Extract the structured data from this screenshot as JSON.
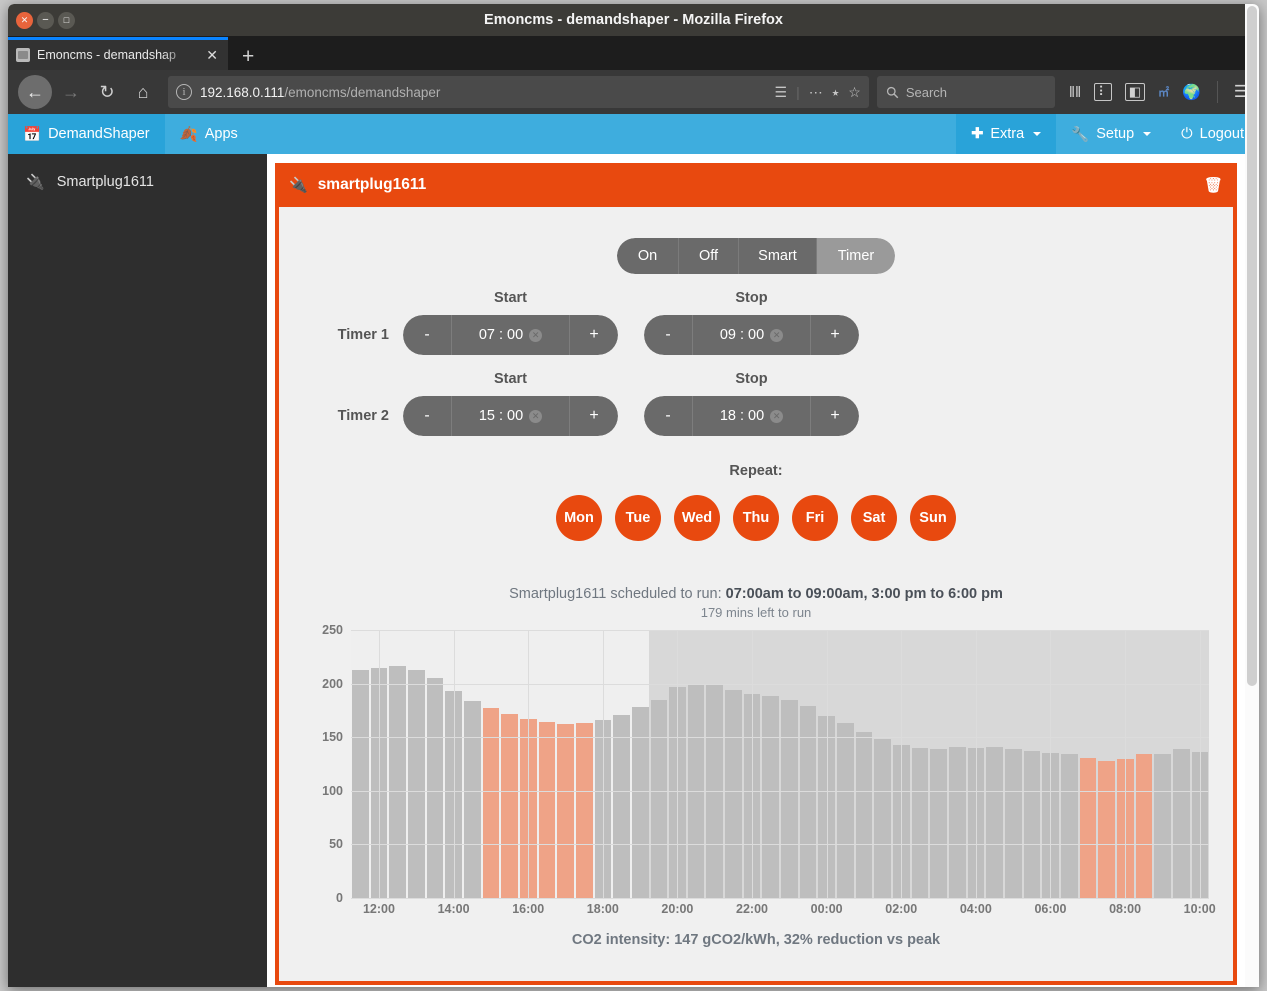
{
  "window": {
    "title": "Emoncms - demandshaper - Mozilla Firefox",
    "close_label": "✕",
    "minimize_label": "−",
    "maximize_label": "□"
  },
  "browser": {
    "tab": {
      "title": "Emoncms - demandshap",
      "close_label": "✕"
    },
    "new_tab_label": "+",
    "back_label": "←",
    "forward_label": "→",
    "reload_label": "↻",
    "home_label": "⌂",
    "url": {
      "host": "192.168.0.111",
      "path": "/emoncms/demandshaper",
      "info_label": "i"
    },
    "url_icons": {
      "reader": "☰",
      "more": "⋯",
      "pocket": "⭑",
      "bookmark": "☆"
    },
    "search": {
      "placeholder": "Search",
      "icon": "search-icon"
    },
    "toolbar_icons": [
      "library-icon",
      "sidebar-icon",
      "page-icon",
      "lt-icon",
      "globe-icon",
      "menu-icon"
    ]
  },
  "topnav": {
    "brand": {
      "label": "DemandShaper",
      "icon": "calendar-icon"
    },
    "apps": {
      "label": "Apps",
      "icon": "leaf-icon"
    },
    "extra": {
      "label": "Extra",
      "icon": "plus-icon"
    },
    "setup": {
      "label": "Setup",
      "icon": "wrench-icon"
    },
    "logout": {
      "label": "Logout",
      "icon": "power-icon"
    }
  },
  "sidebar": {
    "items": [
      {
        "label": "Smartplug1611",
        "icon": "plug-icon"
      }
    ]
  },
  "panel": {
    "title": "smartplug1611",
    "icon": "plug-icon",
    "delete_label": "delete-icon"
  },
  "modes": {
    "options": [
      "On",
      "Off",
      "Smart",
      "Timer"
    ],
    "selected": "Timer"
  },
  "timers": [
    {
      "name": "Timer 1",
      "start_label": "Start",
      "stop_label": "Stop",
      "start_value": "07 : 00",
      "stop_value": "09 : 00",
      "minus_label": "-",
      "plus_label": "+",
      "clear_label": "✕"
    },
    {
      "name": "Timer 2",
      "start_label": "Start",
      "stop_label": "Stop",
      "start_value": "15 : 00",
      "stop_value": "18 : 00",
      "minus_label": "-",
      "plus_label": "+",
      "clear_label": "✕"
    }
  ],
  "repeat": {
    "label": "Repeat:",
    "days": [
      {
        "label": "Mon",
        "active": true
      },
      {
        "label": "Tue",
        "active": true
      },
      {
        "label": "Wed",
        "active": true
      },
      {
        "label": "Thu",
        "active": true
      },
      {
        "label": "Fri",
        "active": true
      },
      {
        "label": "Sat",
        "active": true
      },
      {
        "label": "Sun",
        "active": true
      }
    ]
  },
  "schedule": {
    "prefix": "Smartplug1611 scheduled to run: ",
    "times": "07:00am to 09:00am, 3:00 pm to 6:00 pm",
    "remaining": "179 mins left to run"
  },
  "co2": {
    "text": "CO2 intensity: 147 gCO2/kWh, 32% reduction vs peak"
  },
  "colors": {
    "brand_orange": "#e8490f",
    "nav_blue": "#3eadde",
    "nav_blue_active": "#29a3d9",
    "bar_gray": "#bebebe",
    "bar_highlight": "#efa387",
    "plot_bg": "#efefef",
    "plot_shade": "#d8d8d8",
    "mode_bg": "#6a6a6a",
    "mode_selected": "#9a9a9a"
  },
  "chart_data": {
    "type": "bar",
    "title": "",
    "xlabel": "",
    "ylabel": "",
    "ylim": [
      0,
      250
    ],
    "yticks": [
      0,
      50,
      100,
      150,
      200,
      250
    ],
    "grid": true,
    "legend": false,
    "xticks": [
      "12:00",
      "14:00",
      "16:00",
      "18:00",
      "20:00",
      "22:00",
      "00:00",
      "02:00",
      "04:00",
      "06:00",
      "08:00",
      "10:00"
    ],
    "bar_interval_minutes": 30,
    "categories": [
      "11:30",
      "12:00",
      "12:30",
      "13:00",
      "13:30",
      "14:00",
      "14:30",
      "15:00",
      "15:30",
      "16:00",
      "16:30",
      "17:00",
      "17:30",
      "18:00",
      "18:30",
      "19:00",
      "19:30",
      "20:00",
      "20:30",
      "21:00",
      "21:30",
      "22:00",
      "22:30",
      "23:00",
      "23:30",
      "00:00",
      "00:30",
      "01:00",
      "01:30",
      "02:00",
      "02:30",
      "03:00",
      "03:30",
      "04:00",
      "04:30",
      "05:00",
      "05:30",
      "06:00",
      "06:30",
      "07:00",
      "07:30",
      "08:00",
      "08:30",
      "09:00",
      "09:30",
      "10:00"
    ],
    "values": [
      213,
      215,
      216,
      213,
      205,
      193,
      184,
      177,
      172,
      167,
      164,
      162,
      163,
      166,
      171,
      178,
      185,
      197,
      200,
      199,
      194,
      190,
      188,
      185,
      179,
      170,
      163,
      155,
      148,
      143,
      140,
      139,
      141,
      140,
      141,
      139,
      137,
      135,
      134,
      131,
      128,
      130,
      134,
      134,
      139,
      136
    ],
    "highlight_color": "#efa387",
    "base_color": "#bebebe",
    "highlighted_categories": [
      "15:00",
      "15:30",
      "16:00",
      "16:30",
      "17:00",
      "17:30",
      "07:00",
      "07:30",
      "08:00",
      "08:30"
    ],
    "shaded_region": {
      "from": "19:30",
      "to": "10:00",
      "color": "#d8d8d8"
    }
  }
}
